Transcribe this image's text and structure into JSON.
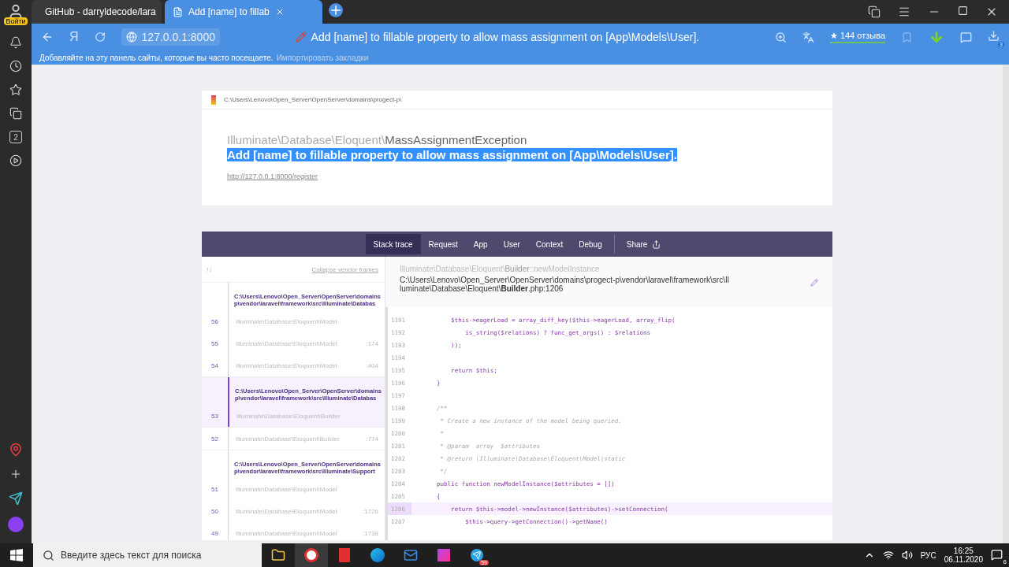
{
  "browser": {
    "account_label": "Войти",
    "tabs": [
      {
        "kind": "github",
        "title": "GitHub - darryldecode/lara",
        "selected": false
      },
      {
        "kind": "page",
        "title": "Add [name] to fillab",
        "selected": true
      }
    ],
    "logo_letter": "Я",
    "address": "127.0.0.1:8000",
    "page_title": "Add [name] to fillable property to allow mass assignment on [App\\Models\\User].",
    "rating": "★ 144 отзыва",
    "downloads_badge": "3",
    "bookmarks_hint": "Добавляйте на эту панель сайты, которые вы часто посещаете.",
    "bookmarks_link": "Импортировать закладки",
    "sidebar_badge": "2"
  },
  "error": {
    "path": "C:\\Users\\Lenovo\\Open_Server\\OpenServer\\domains\\progect-p\\",
    "namespace": "Illuminate\\Database\\Eloquent\\",
    "exception": "MassAssignmentException",
    "message": "Add [name] to fillable property to allow mass assignment on [App\\Models\\User].",
    "url": "http://127.0.0.1:8000/register"
  },
  "tabs": [
    {
      "label": "Stack trace",
      "selected": true
    },
    {
      "label": "Request",
      "selected": false
    },
    {
      "label": "App",
      "selected": false
    },
    {
      "label": "User",
      "selected": false
    },
    {
      "label": "Context",
      "selected": false
    },
    {
      "label": "Debug",
      "selected": false
    }
  ],
  "share": "Share",
  "arrows": "↑↓",
  "collapse": "Collapse vendor frames",
  "frame_groups": [
    {
      "file": [
        "C:\\Users\\Lenovo\\Open_Server\\OpenServer\\domains",
        "p\\vendor\\laravel\\framework\\src\\Illuminate\\Databas"
      ],
      "selected": false,
      "frames": [
        {
          "number": "56",
          "class": "Illuminate\\Database\\Eloquent\\Model"
        },
        {
          "number": "55",
          "class": "Illuminate\\Database\\Eloquent\\Model",
          "line": ":174"
        },
        {
          "number": "54",
          "class": "Illuminate\\Database\\Eloquent\\Model",
          "line": ":404"
        }
      ]
    },
    {
      "file": [
        "C:\\Users\\Lenovo\\Open_Server\\OpenServer\\domains",
        "p\\vendor\\laravel\\framework\\src\\Illuminate\\Databas"
      ],
      "selected": true,
      "frames": [
        {
          "number": "53",
          "class": "Illuminate\\Database\\Eloquent\\Builder"
        }
      ]
    },
    {
      "selected": false,
      "frames": [
        {
          "number": "52",
          "class": "Illuminate\\Database\\Eloquent\\Builder",
          "line": ":774"
        }
      ]
    },
    {
      "file": [
        "C:\\Users\\Lenovo\\Open_Server\\OpenServer\\domains",
        "p\\vendor\\laravel\\framework\\src\\Illuminate\\Support"
      ],
      "selected": false,
      "frames": [
        {
          "number": "51",
          "class": "Illuminate\\Database\\Eloquent\\Model"
        },
        {
          "number": "50",
          "class": "Illuminate\\Database\\Eloquent\\Model",
          "line": ":1726"
        },
        {
          "number": "49",
          "class": "Illuminate\\Database\\Eloquent\\Model",
          "line": ":1738"
        }
      ]
    }
  ],
  "frame_title": {
    "namespace": "Illuminate\\Database\\Eloquent\\",
    "class": "Builder",
    "method": "::newModelInstance"
  },
  "frame_file": {
    "path": "C:\\Users\\Lenovo\\Open_Server\\OpenServer\\domains\\progect-p\\vendor\\laravel\\framework\\src\\Illuminate\\Database\\Eloquent\\",
    "name": "Builder",
    "suffix": ".php:1206"
  },
  "code": [
    {
      "number": "1191",
      "text": "        $this->eagerLoad = array_diff_key($this->eagerLoad, array_flip(",
      "kind": "code",
      "highlighted": false
    },
    {
      "number": "1192",
      "text": "            is_string($relations) ? func_get_args() : $relations",
      "kind": "code",
      "highlighted": false
    },
    {
      "number": "1193",
      "text": "        ));",
      "kind": "code",
      "highlighted": false
    },
    {
      "number": "1194",
      "highlighted": false
    },
    {
      "number": "1195",
      "text": "        return $this;",
      "kind": "code",
      "highlighted": false
    },
    {
      "number": "1196",
      "text": "    }",
      "kind": "code",
      "highlighted": false
    },
    {
      "number": "1197",
      "highlighted": false
    },
    {
      "number": "1198",
      "text": "    /**",
      "kind": "comment",
      "highlighted": false
    },
    {
      "number": "1199",
      "text": "     * Create a new instance of the model being queried.",
      "kind": "comment",
      "highlighted": false
    },
    {
      "number": "1200",
      "text": "     *",
      "kind": "comment",
      "highlighted": false
    },
    {
      "number": "1201",
      "text": "     * @param  array  $attributes",
      "kind": "comment",
      "highlighted": false
    },
    {
      "number": "1202",
      "text": "     * @return \\Illuminate\\Database\\Eloquent\\Model|static",
      "kind": "comment",
      "highlighted": false
    },
    {
      "number": "1203",
      "text": "     */",
      "kind": "comment",
      "highlighted": false
    },
    {
      "number": "1204",
      "text": "    public function newModelInstance($attributes = [])",
      "kind": "code",
      "highlighted": false
    },
    {
      "number": "1205",
      "text": "    {",
      "kind": "code",
      "highlighted": false
    },
    {
      "number": "1206",
      "text": "        return $this->model->newInstance($attributes)->setConnection(",
      "kind": "code",
      "highlighted": true
    },
    {
      "number": "1207",
      "text": "            $this->query->getConnection()->getName()",
      "kind": "code",
      "highlighted": false
    }
  ],
  "taskbar": {
    "search_placeholder": "Введите здесь текст для поиска",
    "telegram_badge": "59",
    "language": "РУС",
    "time": "16:25",
    "date": "06.11.2020",
    "notifications": "6"
  }
}
